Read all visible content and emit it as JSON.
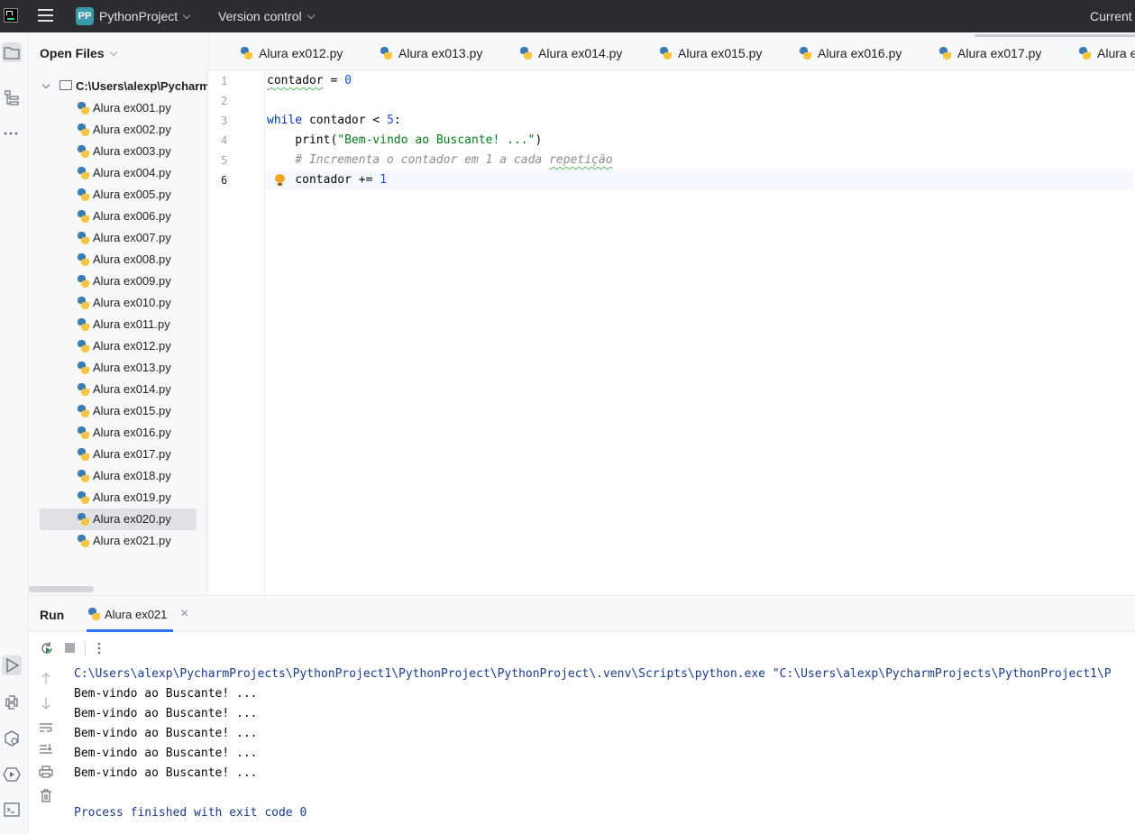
{
  "titlebar": {
    "project_badge": "PP",
    "project_name": "PythonProject",
    "version_control": "Version control",
    "current": "Current"
  },
  "project_panel": {
    "header": "Open Files",
    "folder": "C:\\Users\\alexp\\Pycharm",
    "files": [
      "Alura ex001.py",
      "Alura ex002.py",
      "Alura ex003.py",
      "Alura ex004.py",
      "Alura ex005.py",
      "Alura ex006.py",
      "Alura ex007.py",
      "Alura ex008.py",
      "Alura ex009.py",
      "Alura ex010.py",
      "Alura ex011.py",
      "Alura ex012.py",
      "Alura ex013.py",
      "Alura ex014.py",
      "Alura ex015.py",
      "Alura ex016.py",
      "Alura ex017.py",
      "Alura ex018.py",
      "Alura ex019.py",
      "Alura ex020.py",
      "Alura ex021.py"
    ],
    "selected": "Alura ex020.py"
  },
  "tabs": [
    "Alura ex012.py",
    "Alura ex013.py",
    "Alura ex014.py",
    "Alura ex015.py",
    "Alura ex016.py",
    "Alura ex017.py",
    "Alura e"
  ],
  "editor": {
    "line_numbers": [
      "1",
      "2",
      "3",
      "4",
      "5",
      "6"
    ],
    "current_line": "6",
    "code": {
      "l1_var": "contador",
      "l1_op": " = ",
      "l1_num": "0",
      "l3_kw": "while",
      "l3_rest": " contador < ",
      "l3_num": "5",
      "l3_colon": ":",
      "l4_fn": "    print(",
      "l4_str": "\"Bem-vindo ao Buscante! ...\"",
      "l4_end": ")",
      "l5_cmt_a": "    # Incrementa o contador em 1 a cada ",
      "l5_cmt_b": "repetição",
      "l6_rest": "    contador += ",
      "l6_num": "1"
    }
  },
  "run_panel": {
    "title": "Run",
    "tab_label": "Alura ex021",
    "command": "C:\\Users\\alexp\\PycharmProjects\\PythonProject1\\PythonProject\\PythonProject\\.venv\\Scripts\\python.exe \"C:\\Users\\alexp\\PycharmProjects\\PythonProject1\\P",
    "output_lines": [
      "Bem-vindo ao Buscante! ...",
      "Bem-vindo ao Buscante! ...",
      "Bem-vindo ao Buscante! ...",
      "Bem-vindo ao Buscante! ...",
      "Bem-vindo ao Buscante! ..."
    ],
    "finish": "Process finished with exit code 0"
  },
  "colors": {
    "titlebar_bg": "#2b2d30",
    "accent": "#3574f0",
    "keyword": "#0033b3",
    "number": "#1750eb",
    "string": "#067d17",
    "comment": "#8c8c8c"
  }
}
